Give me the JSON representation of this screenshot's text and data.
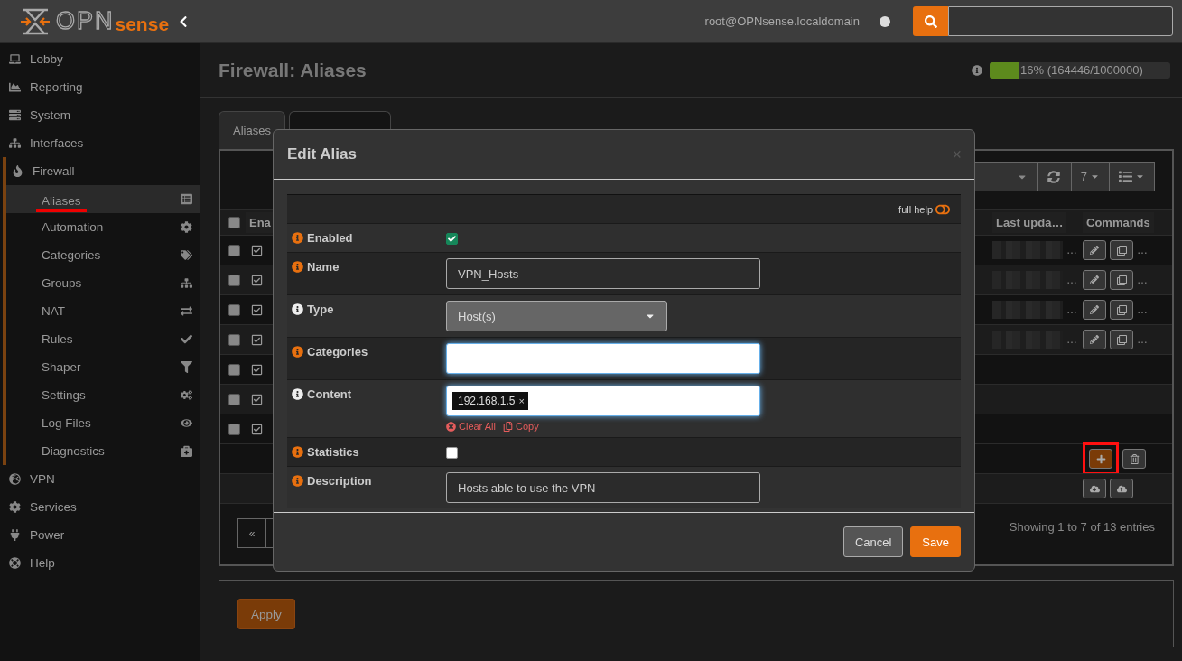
{
  "header": {
    "logo_mark": "OPN",
    "logo_word": "sense",
    "user": "root@OPNsense.localdomain",
    "online": false
  },
  "sidebar": {
    "items": [
      {
        "label": "Lobby",
        "expanded": false
      },
      {
        "label": "Reporting",
        "expanded": false
      },
      {
        "label": "System",
        "expanded": false
      },
      {
        "label": "Interfaces",
        "expanded": false
      },
      {
        "label": "Firewall",
        "expanded": true,
        "children": [
          {
            "label": "Aliases",
            "selected": true
          },
          {
            "label": "Automation",
            "selected": false
          },
          {
            "label": "Categories",
            "selected": false
          },
          {
            "label": "Groups",
            "selected": false
          },
          {
            "label": "NAT",
            "selected": false
          },
          {
            "label": "Rules",
            "selected": false
          },
          {
            "label": "Shaper",
            "selected": false
          },
          {
            "label": "Settings",
            "selected": false
          },
          {
            "label": "Log Files",
            "selected": false
          },
          {
            "label": "Diagnostics",
            "selected": false
          }
        ]
      },
      {
        "label": "VPN",
        "expanded": false
      },
      {
        "label": "Services",
        "expanded": false
      },
      {
        "label": "Power",
        "expanded": false
      },
      {
        "label": "Help",
        "expanded": false
      }
    ]
  },
  "page": {
    "title": "Firewall: Aliases",
    "usage": {
      "level": 0.16,
      "reading": "16% (164446/1000000)"
    }
  },
  "tabs": [
    {
      "label": "Aliases",
      "selected": true
    },
    {
      "selected": false
    }
  ],
  "grid": {
    "page_size": "7",
    "all_selected": false,
    "columns": [
      {
        "label": "Ena"
      },
      {
        "label": "Last upda…"
      },
      {
        "label": "Commands"
      }
    ],
    "rows": [
      {
        "kind": "detailed",
        "selected": false,
        "enabled": true,
        "tail": "…"
      },
      {
        "kind": "detailed",
        "selected": false,
        "enabled": true,
        "tail": "…"
      },
      {
        "kind": "detailed",
        "selected": false,
        "enabled": true,
        "tail": "…"
      },
      {
        "kind": "detailed",
        "selected": false,
        "enabled": true,
        "tail": "…"
      },
      {
        "kind": "basic",
        "selected": false,
        "enabled": true
      },
      {
        "kind": "basic",
        "selected": false,
        "enabled": true
      },
      {
        "kind": "basic",
        "selected": false,
        "enabled": true
      }
    ],
    "command_rows": [
      [
        {
          "kind": "add",
          "highlighted": true
        },
        {
          "kind": "delete",
          "highlighted": false
        }
      ],
      [
        {
          "kind": "download",
          "highlighted": false
        },
        {
          "kind": "upload",
          "highlighted": false
        }
      ]
    ],
    "pagination": [
      {
        "label": "«"
      }
    ],
    "info": "Showing 1 to 7 of 13 entries"
  },
  "apply_button": "Apply",
  "dialog": {
    "title": "Edit Alias",
    "close": "×",
    "help_label": "full help",
    "help_on": false,
    "fields": [
      {
        "kind": "checkbox",
        "label": "Enabled",
        "checked": true,
        "color": "#e8700f"
      },
      {
        "kind": "text",
        "label": "Name",
        "value": "VPN_Hosts",
        "focused": false,
        "color": "#e8700f"
      },
      {
        "kind": "select",
        "label": "Type",
        "value": "Host(s)",
        "color": "#eeeeee"
      },
      {
        "kind": "text",
        "label": "Categories",
        "focused": true,
        "color": "#e8700f"
      },
      {
        "kind": "tags",
        "label": "Content",
        "tags": [
          "192.168.1.5"
        ],
        "tag_remove": "×",
        "clear_label": "Clear All",
        "copy_label": "Copy",
        "focused": true,
        "color": "#eeeeee"
      },
      {
        "kind": "checkbox",
        "label": "Statistics",
        "checked": false,
        "color": "#e8700f"
      },
      {
        "kind": "text",
        "label": "Description",
        "value": "Hosts able to use the VPN",
        "focused": false,
        "color": "#e8700f"
      }
    ],
    "buttons": [
      {
        "label": "Cancel",
        "kind": "secondary"
      },
      {
        "label": "Save",
        "kind": "primary"
      }
    ]
  }
}
